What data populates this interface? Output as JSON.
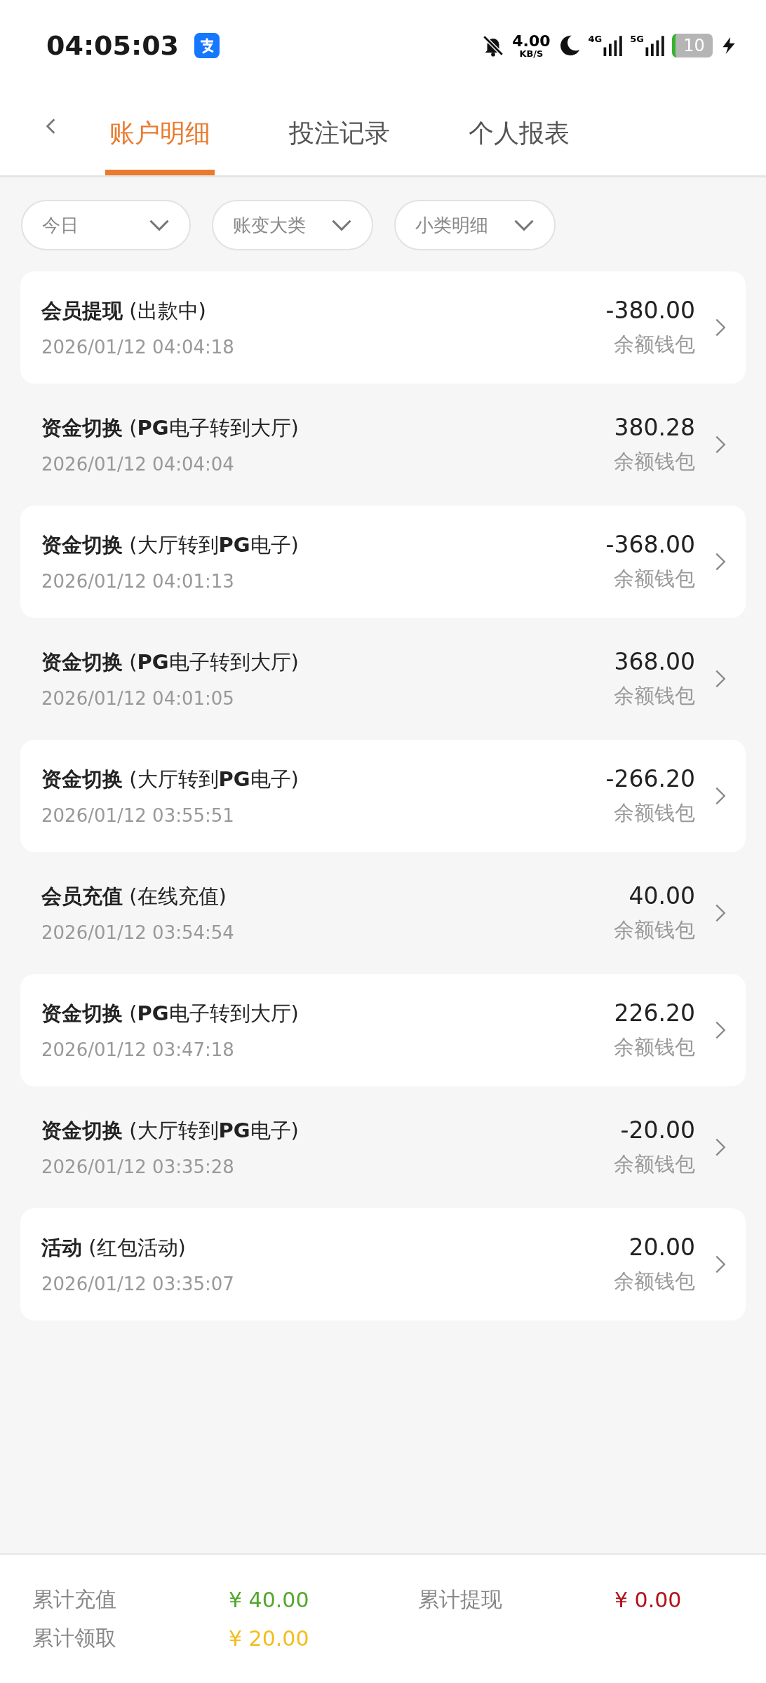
{
  "status_bar": {
    "time": "04:05:03",
    "net_speed": "4.00",
    "net_unit": "KB/S",
    "sim1": "4G",
    "sim2": "5G",
    "battery": "10"
  },
  "tabs": [
    {
      "label": "账户明细",
      "selected": true
    },
    {
      "label": "投注记录",
      "selected": false
    },
    {
      "label": "个人报表",
      "selected": false
    }
  ],
  "filters": [
    "今日",
    "账变大类",
    "小类明细"
  ],
  "records": [
    {
      "type": "会员提现",
      "detail": "(出款中)",
      "time": "2026/01/12 04:04:18",
      "amount": "-380.00",
      "wallet": "余额钱包"
    },
    {
      "type": "资金切换",
      "detail": "(**PG**电子转到大厅)",
      "time": "2026/01/12 04:04:04",
      "amount": "380.28",
      "wallet": "余额钱包"
    },
    {
      "type": "资金切换",
      "detail": "(大厅转到**PG**电子)",
      "time": "2026/01/12 04:01:13",
      "amount": "-368.00",
      "wallet": "余额钱包"
    },
    {
      "type": "资金切换",
      "detail": "(**PG**电子转到大厅)",
      "time": "2026/01/12 04:01:05",
      "amount": "368.00",
      "wallet": "余额钱包"
    },
    {
      "type": "资金切换",
      "detail": "(大厅转到**PG**电子)",
      "time": "2026/01/12 03:55:51",
      "amount": "-266.20",
      "wallet": "余额钱包"
    },
    {
      "type": "会员充值",
      "detail": "(在线充值)",
      "time": "2026/01/12 03:54:54",
      "amount": "40.00",
      "wallet": "余额钱包"
    },
    {
      "type": "资金切换",
      "detail": "(**PG**电子转到大厅)",
      "time": "2026/01/12 03:47:18",
      "amount": "226.20",
      "wallet": "余额钱包"
    },
    {
      "type": "资金切换",
      "detail": "(大厅转到**PG**电子)",
      "time": "2026/01/12 03:35:28",
      "amount": "-20.00",
      "wallet": "余额钱包"
    },
    {
      "type": "活动",
      "detail": "(红包活动)",
      "time": "2026/01/12 03:35:07",
      "amount": "20.00",
      "wallet": "余额钱包"
    }
  ],
  "totals": [
    {
      "label": "累计充值",
      "value": "¥ 40.00",
      "color": "#52a82c"
    },
    {
      "label": "累计提现",
      "value": "¥ 0.00",
      "color": "#b3121b"
    },
    {
      "label": "累计领取",
      "value": "¥ 20.00",
      "color": "#f2bd1d"
    }
  ]
}
